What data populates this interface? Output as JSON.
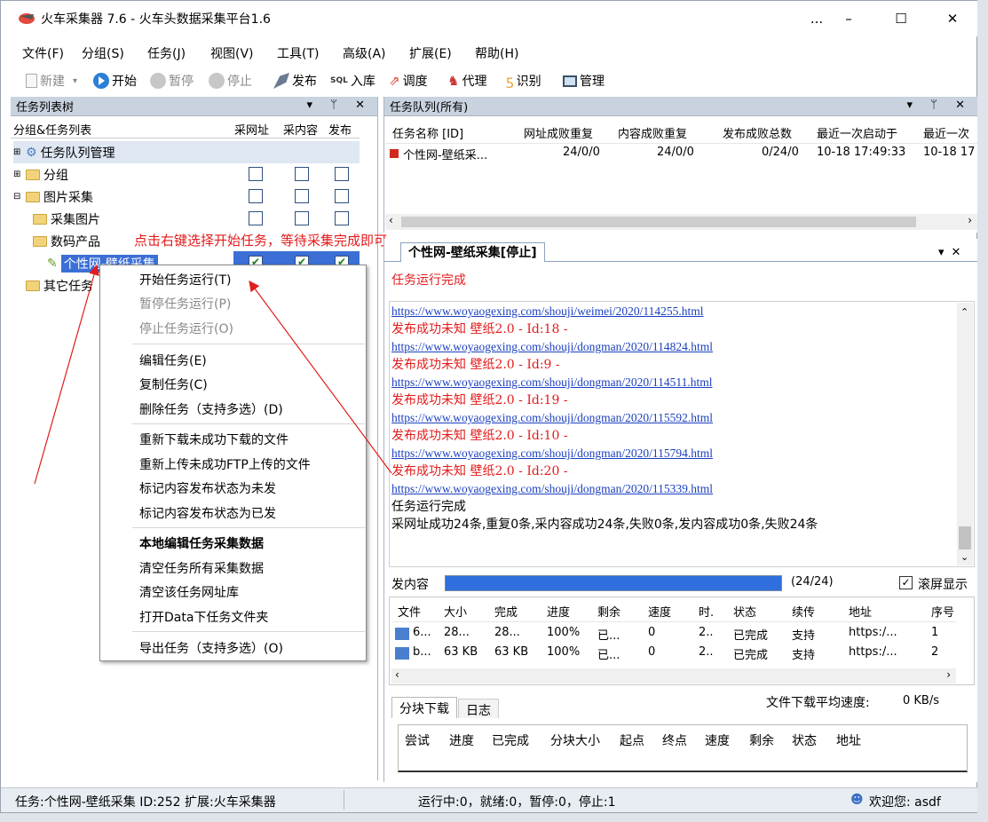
{
  "window": {
    "title": "火车采集器 7.6 - 火车头数据采集平台1.6",
    "min": "–",
    "max": "☐",
    "close": "✕",
    "more": "..."
  },
  "menu": [
    "文件(F)",
    "分组(S)",
    "任务(J)",
    "视图(V)",
    "工具(T)",
    "高级(A)",
    "扩展(E)",
    "帮助(H)"
  ],
  "toolbar": {
    "new": "新建",
    "start": "开始",
    "pause": "暂停",
    "stop": "停止",
    "publish": "发布",
    "import": "入库",
    "schedule": "调度",
    "proxy": "代理",
    "identify": "识别",
    "manage": "管理",
    "sql_label": "SQL"
  },
  "task_tree": {
    "title": "任务列表树",
    "pin": "▾ ᛘ ✕",
    "headers": [
      "分组&任务列表",
      "采网址",
      "采内容",
      "发布"
    ],
    "rows": [
      {
        "label": "任务队列管理"
      },
      {
        "label": "分组"
      },
      {
        "label": "图片采集"
      },
      {
        "label": "采集图片"
      },
      {
        "label": "数码产品"
      },
      {
        "label": "个性网-壁纸采集"
      },
      {
        "label": "其它任务"
      }
    ]
  },
  "annotation": "点击右键选择开始任务，等待采集完成即可",
  "context_menu": {
    "items": [
      "开始任务运行(T)",
      "暂停任务运行(P)",
      "停止任务运行(O)",
      "编辑任务(E)",
      "复制任务(C)",
      "删除任务（支持多选）(D)",
      "重新下载未成功下载的文件",
      "重新上传未成功FTP上传的文件",
      "标记内容发布状态为未发",
      "标记内容发布状态为已发",
      "本地编辑任务采集数据",
      "清空任务所有采集数据",
      "清空该任务网址库",
      "打开Data下任务文件夹",
      "导出任务（支持多选）(O)"
    ]
  },
  "queue": {
    "title": "任务队列(所有)",
    "headers": [
      "任务名称 [ID]",
      "网址成败重复",
      "内容成败重复",
      "发布成败总数",
      "最近一次启动于",
      "最近一次"
    ],
    "row": [
      "个性网-壁纸采...",
      "24/0/0",
      "24/0/0",
      "0/24/0",
      "10-18 17:49:33",
      "10-18 17"
    ]
  },
  "task_tab": {
    "label": "个性网-壁纸采集[停止]",
    "status": "任务运行完成",
    "log": [
      {
        "t": "url",
        "v": "https://www.woyaogexing.com/shouji/weimei/2020/114255.html"
      },
      {
        "t": "red",
        "v": "发布成功未知 壁纸2.0 - Id:18 -"
      },
      {
        "t": "url",
        "v": "https://www.woyaogexing.com/shouji/dongman/2020/114824.html"
      },
      {
        "t": "red",
        "v": "发布成功未知 壁纸2.0 - Id:9 -"
      },
      {
        "t": "url",
        "v": "https://www.woyaogexing.com/shouji/dongman/2020/114511.html"
      },
      {
        "t": "red",
        "v": "发布成功未知 壁纸2.0 - Id:19 -"
      },
      {
        "t": "url",
        "v": "https://www.woyaogexing.com/shouji/dongman/2020/115592.html"
      },
      {
        "t": "red",
        "v": "发布成功未知 壁纸2.0 - Id:10 -"
      },
      {
        "t": "url",
        "v": "https://www.woyaogexing.com/shouji/dongman/2020/115794.html"
      },
      {
        "t": "red",
        "v": "发布成功未知 壁纸2.0 - Id:20 -"
      },
      {
        "t": "url",
        "v": "https://www.woyaogexing.com/shouji/dongman/2020/115339.html"
      },
      {
        "t": "blk",
        "v": "任务运行完成"
      },
      {
        "t": "blk",
        "v": "采网址成功24条,重复0条,采内容成功24条,失败0条,发内容成功0条,失败24条"
      }
    ]
  },
  "progress": {
    "label": "发内容",
    "count": "(24/24)",
    "fraction": 1.0,
    "fullscreen": "滚屏显示"
  },
  "files": {
    "headers": [
      "文件",
      "大小",
      "完成",
      "进度",
      "剩余",
      "速度",
      "时.",
      "状态",
      "续传",
      "地址",
      "序号"
    ],
    "rows": [
      [
        "6...",
        "28...",
        "28...",
        "100%",
        "已...",
        "0",
        "2..",
        "已完成",
        "支持",
        "https:/...",
        "1"
      ],
      [
        "b...",
        "63 KB",
        "63 KB",
        "100%",
        "已...",
        "0",
        "2..",
        "已完成",
        "支持",
        "https:/...",
        "2"
      ]
    ]
  },
  "bottom_tabs": {
    "tab1": "分块下载",
    "tab2": "日志",
    "avg_speed_label": "文件下载平均速度:",
    "avg_speed": "0 KB/s"
  },
  "chunk_headers": [
    "尝试",
    "进度",
    "已完成",
    "分块大小",
    "起点",
    "终点",
    "速度",
    "剩余",
    "状态",
    "地址"
  ],
  "status": {
    "task": "任务:个性网-壁纸采集  ID:252  扩展:火车采集器",
    "run": "运行中:0，就绪:0，暂停:0，停止:1",
    "welcome": "欢迎您:  asdf"
  },
  "colors": {
    "accent": "#3b6fd6",
    "annotation": "#e31b1b",
    "panel": "#c9d3df"
  }
}
